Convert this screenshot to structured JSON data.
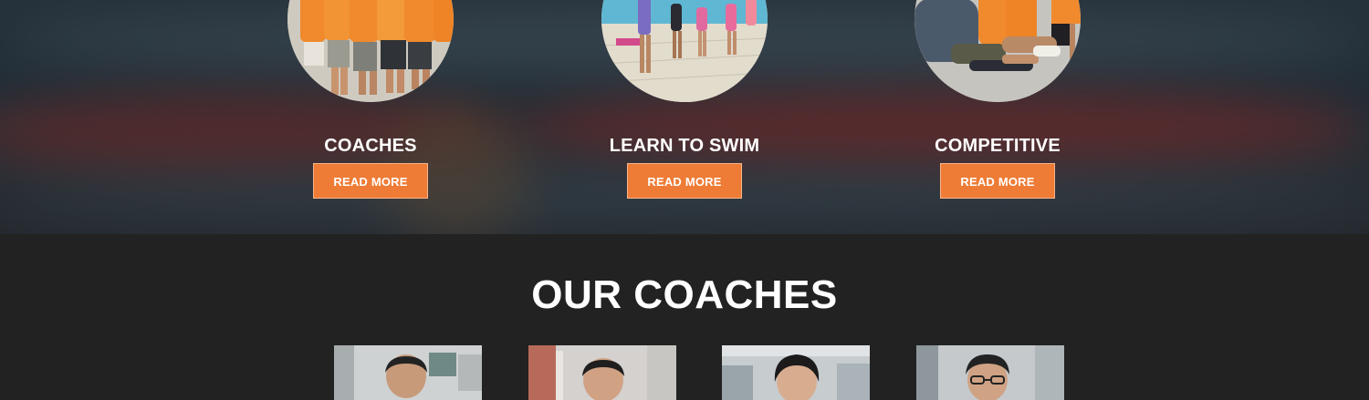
{
  "programs": [
    {
      "title": "COACHES",
      "button_label": "READ MORE",
      "photo": "team-in-orange-shirts-photo"
    },
    {
      "title": "LEARN TO SWIM",
      "button_label": "READ MORE",
      "photo": "kids-at-pool-photo"
    },
    {
      "title": "COMPETITIVE",
      "button_label": "READ MORE",
      "photo": "swimmers-sitting-photo"
    }
  ],
  "coaches_section": {
    "title": "OUR COACHES",
    "coaches": [
      {
        "photo": "coach-portrait-1"
      },
      {
        "photo": "coach-portrait-2"
      },
      {
        "photo": "coach-portrait-3"
      },
      {
        "photo": "coach-portrait-4"
      }
    ]
  },
  "colors": {
    "accent": "#ee7c36",
    "dark_background": "#222222",
    "heading_text": "#ffffff"
  }
}
